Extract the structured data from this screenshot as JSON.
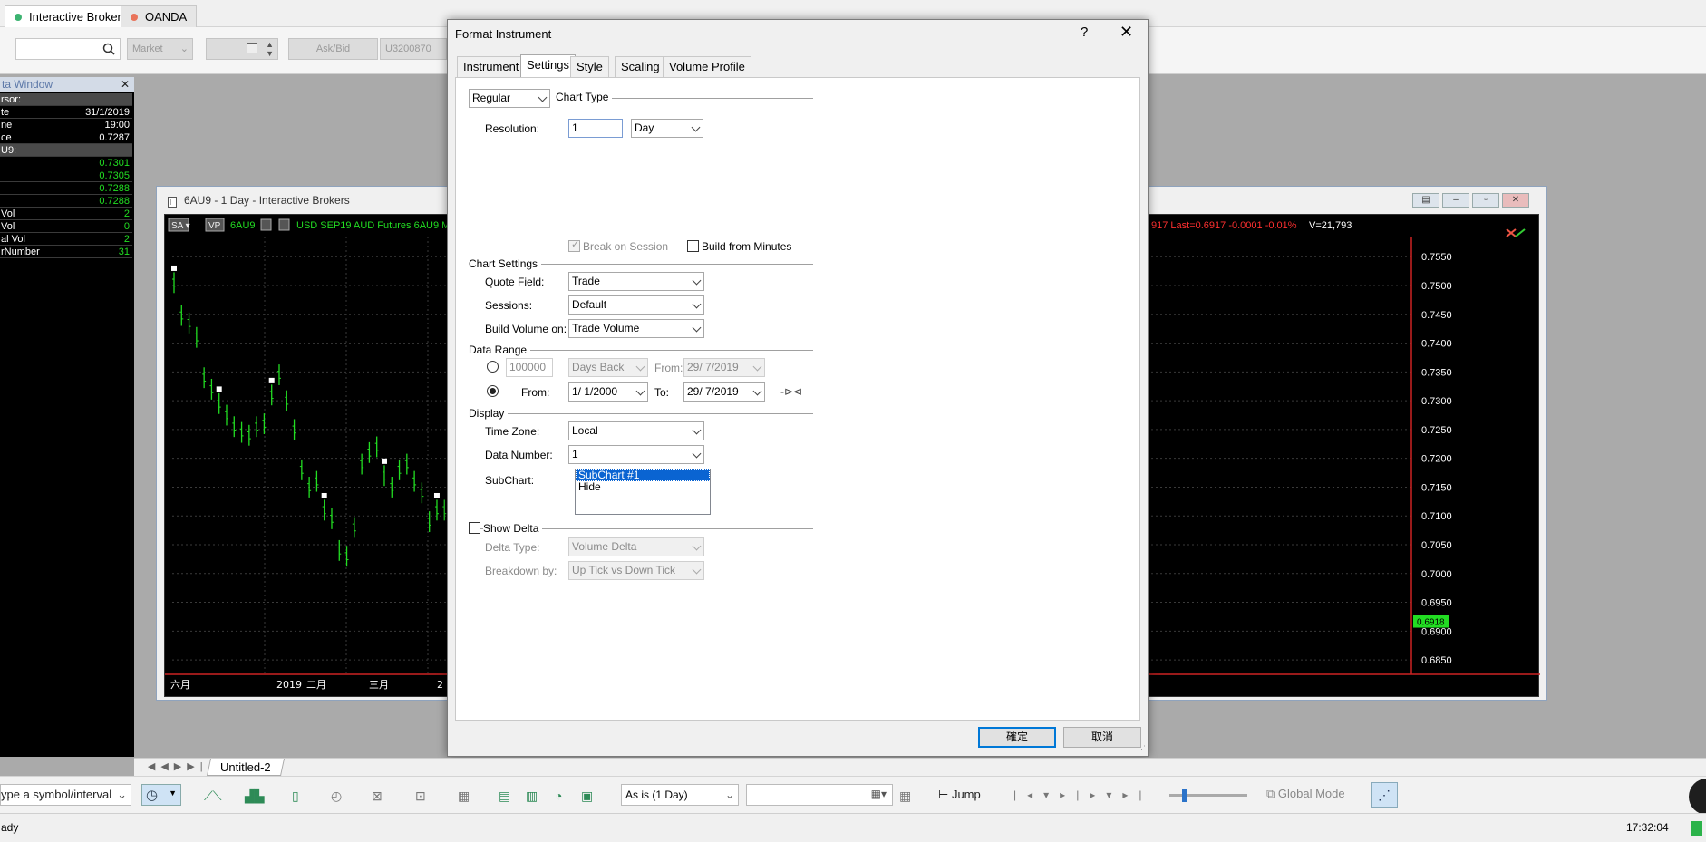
{
  "broker_tabs": [
    {
      "label": "Interactive Brokers",
      "color": "#3cb371"
    },
    {
      "label": "OANDA",
      "color": "#e9735a"
    }
  ],
  "toolbar": {
    "order_type": "Market",
    "price_mode": "Ask/Bid",
    "account": "U3200870"
  },
  "data_window": {
    "title": "ta Window",
    "rows": [
      {
        "label": "rsor:",
        "value": "",
        "header": true
      },
      {
        "label": "te",
        "value": "31/1/2019",
        "color": "#ffffff"
      },
      {
        "label": "ne",
        "value": "19:00",
        "color": "#ffffff"
      },
      {
        "label": "ce",
        "value": "0.7287",
        "color": "#ffffff"
      },
      {
        "label": "U9:",
        "value": "",
        "header": true
      },
      {
        "label": "",
        "value": "0.7301",
        "color": "#22dd22"
      },
      {
        "label": "",
        "value": "0.7305",
        "color": "#22dd22"
      },
      {
        "label": "",
        "value": "0.7288",
        "color": "#22dd22"
      },
      {
        "label": "",
        "value": "0.7288",
        "color": "#22dd22"
      },
      {
        "label": "Vol",
        "value": "2",
        "color": "#22dd22"
      },
      {
        "label": "Vol",
        "value": "0",
        "color": "#22dd22"
      },
      {
        "label": "al Vol",
        "value": "2",
        "color": "#22dd22"
      },
      {
        "label": "rNumber",
        "value": "31",
        "color": "#22dd22"
      }
    ]
  },
  "chart_window": {
    "title": "6AU9 - 1 Day - Interactive Brokers",
    "header_left": "USD SEP19 AUD Futures 6AU9 MU",
    "symbol": "6AU9",
    "header_right": "917  Last=0.6917  -0.0001  -0.01%",
    "volume": "V=21,793",
    "price_ticks": [
      "0.7550",
      "0.7500",
      "0.7450",
      "0.7400",
      "0.7350",
      "0.7300",
      "0.7250",
      "0.7200",
      "0.7150",
      "0.7100",
      "0.7050",
      "0.7000",
      "0.6950",
      "0.6900",
      "0.6850"
    ],
    "last_price": "0.6918",
    "time_labels": [
      "六月",
      "2019",
      "二月",
      "三月",
      "2"
    ]
  },
  "chart_data": {
    "type": "bar",
    "title": "6AU9 - 1 Day - Interactive Brokers",
    "ylim": [
      0.6825,
      0.7585
    ],
    "y_ticks": [
      0.755,
      0.75,
      0.745,
      0.74,
      0.735,
      0.73,
      0.725,
      0.72,
      0.715,
      0.71,
      0.705,
      0.7,
      0.695,
      0.69,
      0.685
    ],
    "x_labels": [
      "六月",
      "2019",
      "二月",
      "三月",
      "2"
    ],
    "last": 0.6917,
    "series": [
      {
        "values": [
          0.7505,
          0.7448,
          0.7435,
          0.741,
          0.734,
          0.732,
          0.7295,
          0.7275,
          0.7255,
          0.7245,
          0.724,
          0.7255,
          0.726,
          0.731,
          0.7345,
          0.73,
          0.725,
          0.718,
          0.715,
          0.716,
          0.711,
          0.7095,
          0.704,
          0.703,
          0.708,
          0.719,
          0.721,
          0.722,
          0.717,
          0.715,
          0.718,
          0.719,
          0.716,
          0.714,
          0.709,
          0.711,
          0.711,
          0.714,
          0.715,
          0.712,
          0.707,
          0.711,
          0.715,
          0.716,
          0.714,
          0.712,
          0.711,
          0.713,
          0.716,
          0.714
        ]
      }
    ]
  },
  "dialog": {
    "title": "Format Instrument",
    "help": "?",
    "close": "✕",
    "tabs": [
      "Instrument",
      "Settings",
      "Style",
      "Scaling",
      "Volume Profile"
    ],
    "chart_type_select": "Regular",
    "chart_type_label": "Chart Type",
    "resolution_label": "Resolution:",
    "resolution_value": "1",
    "resolution_unit": "Day",
    "break_on_session": "Break on Session",
    "build_from_minutes": "Build from Minutes",
    "chart_settings": "Chart Settings",
    "quote_field_label": "Quote Field:",
    "quote_field": "Trade",
    "sessions_label": "Sessions:",
    "sessions": "Default",
    "build_volume_label": "Build Volume on:",
    "build_volume": "Trade Volume",
    "data_range": "Data Range",
    "days_back_value": "100000",
    "days_back": "Days Back",
    "from1_label": "From:",
    "from1_date": "29/ 7/2019",
    "from_label": "From:",
    "from_date": "1/ 1/2000",
    "to_label": "To:",
    "to_date": "29/ 7/2019",
    "display": "Display",
    "time_zone_label": "Time Zone:",
    "time_zone": "Local",
    "data_number_label": "Data Number:",
    "data_number": "1",
    "subchart_label": "SubChart:",
    "subchart_options": [
      "SubChart #1",
      "Hide"
    ],
    "show_delta": "Show Delta",
    "delta_type_label": "Delta Type:",
    "delta_type": "Volume Delta",
    "breakdown_label": "Breakdown by:",
    "breakdown": "Up Tick vs Down Tick",
    "ok": "確定",
    "cancel": "取消"
  },
  "sheet_tab": "Untitled-2",
  "bottom_toolbar": {
    "symbol_placeholder": "ype a symbol/interval",
    "interval": "As is (1 Day)",
    "jump": "Jump",
    "global_mode": "Global Mode"
  },
  "status": {
    "left": "ady",
    "time": "17:32:04"
  }
}
